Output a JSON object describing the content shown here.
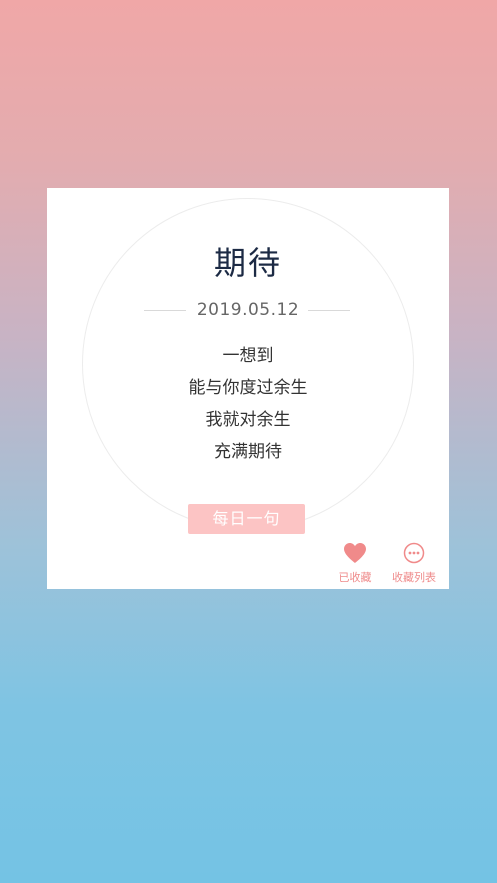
{
  "card": {
    "title": "期待",
    "date": "2019.05.12",
    "poem": [
      "一想到",
      "能与你度过余生",
      "我就对余生",
      "充满期待"
    ],
    "daily_button": "每日一句",
    "actions": {
      "favorited": {
        "label": "已收藏",
        "icon": "heart-icon"
      },
      "favorites_list": {
        "label": "收藏列表",
        "icon": "more-circle-icon"
      }
    }
  },
  "colors": {
    "accent": "#f08a8a",
    "button_bg": "#fcc4c4",
    "title": "#1c2a44",
    "gradient_top": "#f0a7a7",
    "gradient_bottom": "#74c3e4"
  }
}
